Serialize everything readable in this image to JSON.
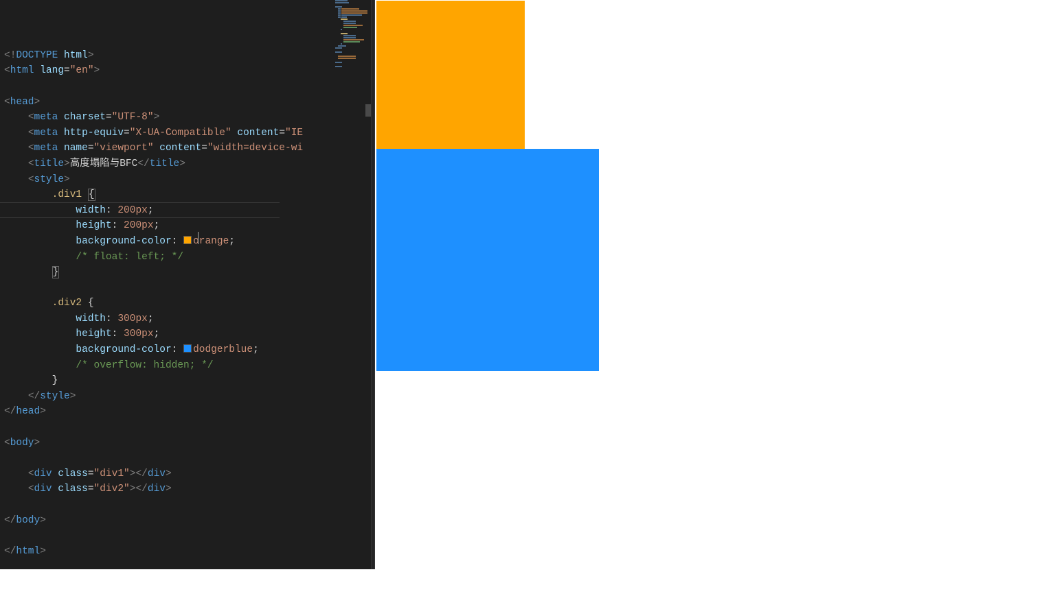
{
  "editor": {
    "doctype": "DOCTYPE",
    "doctype_val": "html",
    "html_tag": "html",
    "lang_attr": "lang",
    "lang_val": "\"en\"",
    "head_tag": "head",
    "meta_tag": "meta",
    "charset_attr": "charset",
    "charset_val": "\"UTF-8\"",
    "httpequiv_attr": "http-equiv",
    "httpequiv_val": "\"X-UA-Compatible\"",
    "content_attr": "content",
    "content_ie": "\"IE",
    "name_attr": "name",
    "viewport_val": "\"viewport\"",
    "content_width": "\"width=device-wi",
    "title_tag": "title",
    "title_text": "高度塌陷与BFC",
    "style_tag": "style",
    "sel1": ".div1",
    "sel2": ".div2",
    "prop_width": "width",
    "prop_height": "height",
    "prop_bg": "background-color",
    "val_200": " 200px",
    "val_300": " 300px",
    "val_orange": "orange",
    "val_blue": "dodgerblue",
    "comment_float": "/* float: left; */",
    "comment_overflow": "/* overflow: hidden; */",
    "body_tag": "body",
    "div_tag": "div",
    "class_attr": "class",
    "class_div1": "\"div1\"",
    "class_div2": "\"div2\"",
    "open_brace": "{",
    "close_brace": "}",
    "open_brace_hl": "{",
    "close_brace_hl": "}",
    "colon": ":",
    "semi": ";"
  },
  "preview": {
    "box1_color": "orange",
    "box2_color": "dodgerblue"
  }
}
